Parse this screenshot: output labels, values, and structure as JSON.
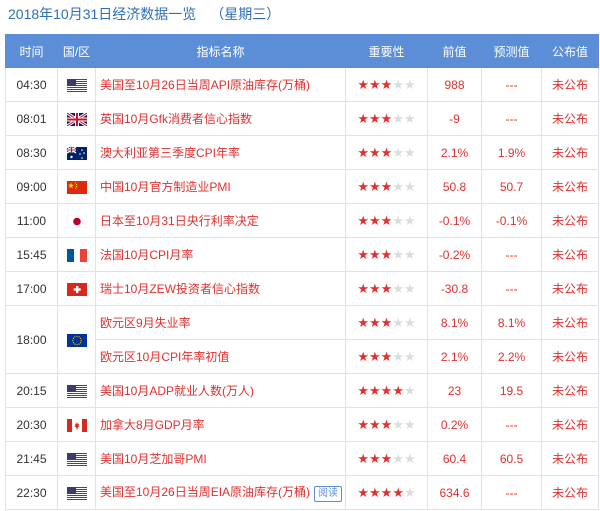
{
  "header": {
    "title": "2018年10月31日经济数据一览",
    "weekday": "（星期三）"
  },
  "columns": {
    "time": "时间",
    "region": "国/区",
    "indicator": "指标名称",
    "importance": "重要性",
    "previous": "前值",
    "forecast": "预测值",
    "actual": "公布值"
  },
  "read_label": "阅读",
  "rows": [
    {
      "time": "04:30",
      "flag": "us",
      "indicator": "美国至10月26日当周API原油库存(万桶)",
      "stars": 3,
      "previous": "988",
      "forecast": "---",
      "actual": "未公布"
    },
    {
      "time": "08:01",
      "flag": "uk",
      "indicator": "英国10月Gfk消费者信心指数",
      "stars": 3,
      "previous": "-9",
      "forecast": "---",
      "actual": "未公布"
    },
    {
      "time": "08:30",
      "flag": "au",
      "indicator": "澳大利亚第三季度CPI年率",
      "stars": 3,
      "previous": "2.1%",
      "forecast": "1.9%",
      "actual": "未公布"
    },
    {
      "time": "09:00",
      "flag": "cn",
      "indicator": "中国10月官方制造业PMI",
      "stars": 3,
      "previous": "50.8",
      "forecast": "50.7",
      "actual": "未公布"
    },
    {
      "time": "11:00",
      "flag": "jp",
      "indicator": "日本至10月31日央行利率决定",
      "stars": 3,
      "previous": "-0.1%",
      "forecast": "-0.1%",
      "actual": "未公布"
    },
    {
      "time": "15:45",
      "flag": "fr",
      "indicator": "法国10月CPI月率",
      "stars": 3,
      "previous": "-0.2%",
      "forecast": "---",
      "actual": "未公布"
    },
    {
      "time": "17:00",
      "flag": "ch",
      "indicator": "瑞士10月ZEW投资者信心指数",
      "stars": 3,
      "previous": "-30.8",
      "forecast": "---",
      "actual": "未公布"
    },
    {
      "time": "18:00",
      "flag": "eu",
      "indicator": "欧元区9月失业率",
      "stars": 3,
      "previous": "8.1%",
      "forecast": "8.1%",
      "actual": "未公布",
      "span": 2
    },
    {
      "time": "",
      "flag": "",
      "indicator": "欧元区10月CPI年率初值",
      "stars": 3,
      "previous": "2.1%",
      "forecast": "2.2%",
      "actual": "未公布",
      "cont": true
    },
    {
      "time": "20:15",
      "flag": "us",
      "indicator": "美国10月ADP就业人数(万人)",
      "stars": 4,
      "previous": "23",
      "forecast": "19.5",
      "actual": "未公布"
    },
    {
      "time": "20:30",
      "flag": "ca",
      "indicator": "加拿大8月GDP月率",
      "stars": 3,
      "previous": "0.2%",
      "forecast": "---",
      "actual": "未公布"
    },
    {
      "time": "21:45",
      "flag": "us",
      "indicator": "美国10月芝加哥PMI",
      "stars": 3,
      "previous": "60.4",
      "forecast": "60.5",
      "actual": "未公布"
    },
    {
      "time": "22:30",
      "flag": "us",
      "indicator": "美国至10月26日当周EIA原油库存(万桶)",
      "stars": 4,
      "previous": "634.6",
      "forecast": "---",
      "actual": "未公布",
      "read": true
    }
  ]
}
